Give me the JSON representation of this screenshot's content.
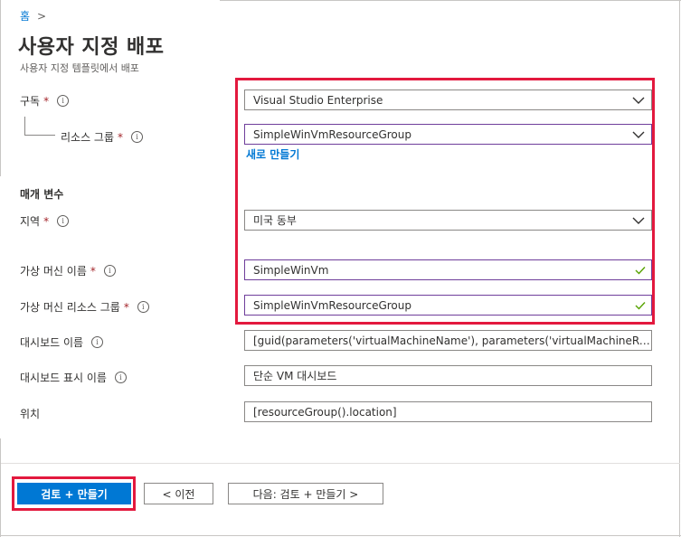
{
  "breadcrumb": {
    "home": "홈",
    "separator": ">"
  },
  "page": {
    "title": "사용자 지정 배포",
    "subtitle": "사용자 지정 템플릿에서 배포"
  },
  "fields": {
    "subscription": {
      "label": "구독",
      "required": "*",
      "value": "Visual Studio Enterprise"
    },
    "resource_group": {
      "label": "리소스 그룹",
      "required": "*",
      "value": "SimpleWinVmResourceGroup",
      "create_new": "새로 만들기"
    },
    "section_params": "매개 변수",
    "region": {
      "label": "지역",
      "required": "*",
      "value": "미국 동부"
    },
    "vm_name": {
      "label": "가상 머신 이름",
      "required": "*",
      "value": "SimpleWinVm"
    },
    "vm_rg": {
      "label": "가상 머신 리소스 그룹",
      "required": "*",
      "value": "SimpleWinVmResourceGroup"
    },
    "dashboard_name": {
      "label": "대시보드 이름",
      "value": "[guid(parameters('virtualMachineName'), parameters('virtualMachineResourceGroup'))]"
    },
    "dashboard_display": {
      "label": "대시보드 표시 이름",
      "value": "단순 VM 대시보드"
    },
    "location": {
      "label": "위치",
      "value": "[resourceGroup().location]"
    }
  },
  "buttons": {
    "review_create": "검토 + 만들기",
    "previous": "< 이전",
    "next": "다음: 검토 + 만들기 >"
  },
  "icons": {
    "info": "i",
    "chevron": "chevron-down-icon",
    "check": "checkmark-icon"
  },
  "colors": {
    "accent": "#0078d4",
    "highlight": "#e3193e",
    "required": "#a4262c",
    "valid": "#57a300"
  }
}
